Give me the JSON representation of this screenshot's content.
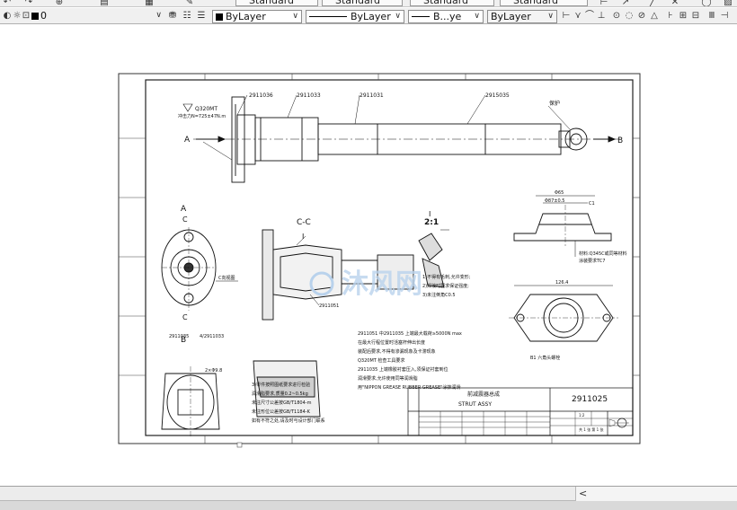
{
  "toolbar_row1": {
    "text_style": "Standard",
    "dim_style": "Standard",
    "table_style": "Standard",
    "multileader_style": "Standard"
  },
  "toolbar_row2": {
    "layer": "0",
    "color": "ByLayer",
    "linetype": "ByLayer",
    "lineweight": "B...ye",
    "plotstyle": "ByLayer"
  },
  "drawing": {
    "top_labels": [
      "2911036",
      "2911033",
      "2911031",
      "2915035",
      "保护"
    ],
    "left_label_1": "Q320MT",
    "left_label_2": "冲击力N=725±47N.m",
    "axis_a": "A",
    "axis_b": "B",
    "section_a": "A",
    "section_c_top": "C",
    "section_c_bot": "C",
    "section_b": "B",
    "cc_title": "C-C",
    "i_label": "I",
    "detail_title": "I",
    "detail_scale": "2:1",
    "part_2911051": "2911051",
    "part_2911035": "2911035",
    "part_2911033b": "4/2911033",
    "mounting_note": "C向视图",
    "hole_note": "2×Φ9.8",
    "bottom_note": "B1  六角头螺栓",
    "material_note_1": "材料:Q345C或同等材料",
    "material_note_2": "涂装要求TC7",
    "right_dim_1": "Φ65",
    "right_dim_2": "Φ87±0.5",
    "right_dim_3": "Φ95",
    "dim_c1": "C1",
    "dim_width": "126.4",
    "notes": [
      "2911051    中2911035   上端最大载荷≥5000N max",
      "在最大行程位置时活塞杆伸出长度",
      "装配后要求,不得有渗漏现象及卡滞现象",
      "Q320MT  检查工具要求",
      "2911035    上端橡胶衬套压入,须保证衬套到位",
      "润滑要求,允许使用同等润滑脂",
      "用\"NIPPON GREASE RUBBER GREASE\"涂抹润滑"
    ],
    "notes2": [
      "1)不得有毛刺,允许变形;",
      "2)焊接时要求保证强度;",
      "3)未注倒角C0.5"
    ],
    "left_notes": [
      "3)零件按照图纸要求进行检验",
      "润滑脂要求,质量0.2~0.5kg",
      "未注尺寸公差按GB/T1804-m",
      "未注形位公差按GB/T1184-K",
      "如有不符之处,请及时与设计部门联系"
    ],
    "title_block": {
      "part_name_cn": "前减震器总成",
      "part_name_en": "STRUT ASSY",
      "drawing_no": "2911025",
      "scale": "1:2",
      "sheet": "共 1 张 第 1 张"
    },
    "watermark": "沐风网"
  },
  "statusbar": {
    "scroll_left": "<"
  }
}
